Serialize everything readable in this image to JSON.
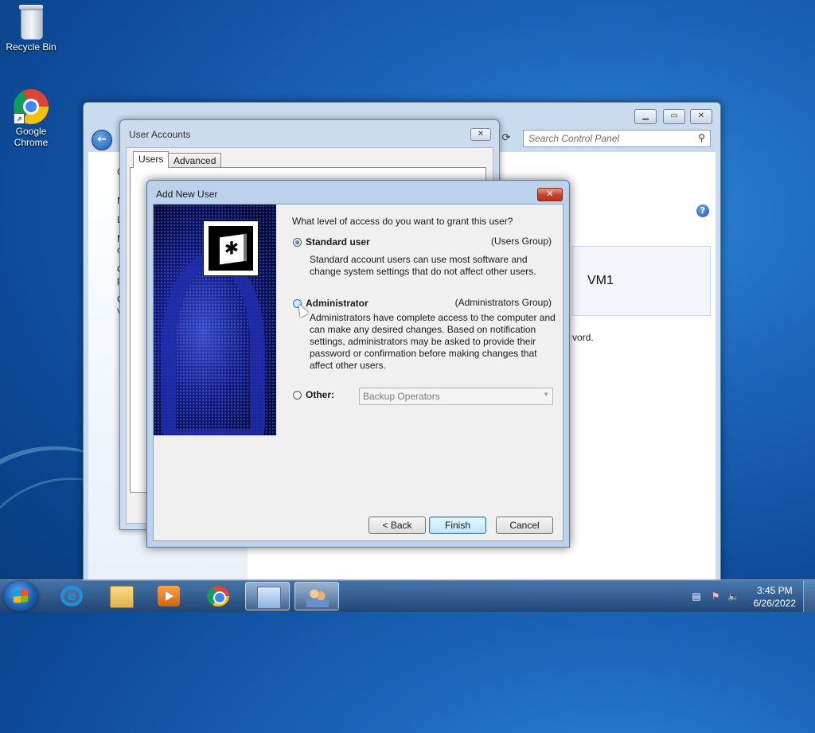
{
  "desktop": {
    "icons": [
      {
        "label": "Recycle Bin"
      },
      {
        "label": "Google Chrome"
      }
    ]
  },
  "control_panel": {
    "search_placeholder": "Search Control Panel",
    "help": "?",
    "account_name": "VM1",
    "fragment_password": "vord.",
    "left_fragments": [
      "C",
      "M",
      "Li",
      "M",
      "ce",
      "C",
      "pu",
      "C",
      "va"
    ]
  },
  "user_accounts": {
    "title": "User Accounts",
    "tabs": [
      "Users",
      "Advanced"
    ]
  },
  "add_new_user": {
    "title": "Add New User",
    "question": "What level of access do you want to grant this user?",
    "options": [
      {
        "label": "Standard user",
        "group": "(Users Group)",
        "description": "Standard account users can use most software and change system settings that do not affect other users.",
        "selected": true
      },
      {
        "label": "Administrator",
        "group": "(Administrators Group)",
        "description": "Administrators have complete access to the computer and can make any desired changes. Based on notification settings, administrators may be asked to provide their password or confirmation before making changes that affect other users.",
        "selected": false
      },
      {
        "label": "Other:",
        "selected": false,
        "dropdown_value": "Backup Operators"
      }
    ],
    "buttons": {
      "back": "< Back",
      "finish": "Finish",
      "cancel": "Cancel"
    }
  },
  "taskbar": {
    "time": "3:45 PM",
    "date": "6/26/2022"
  }
}
